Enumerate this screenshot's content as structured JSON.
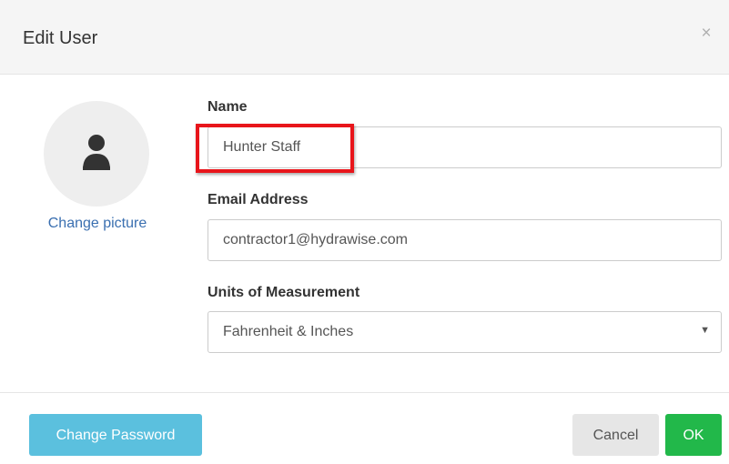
{
  "dialog": {
    "title": "Edit User",
    "close_glyph": "×"
  },
  "avatar": {
    "icon": "user-icon",
    "change_picture_label": "Change picture"
  },
  "form": {
    "name": {
      "label": "Name",
      "value": "Hunter Staff"
    },
    "email": {
      "label": "Email Address",
      "value": "contractor1@hydrawise.com"
    },
    "units": {
      "label": "Units of Measurement",
      "selected": "Fahrenheit & Inches",
      "arrow_glyph": "▼"
    }
  },
  "footer": {
    "change_password_label": "Change Password",
    "cancel_label": "Cancel",
    "ok_label": "OK"
  },
  "colors": {
    "info": "#5bc0de",
    "success": "#22b84a",
    "highlight": "#e8151b",
    "link": "#3a6fb0"
  }
}
